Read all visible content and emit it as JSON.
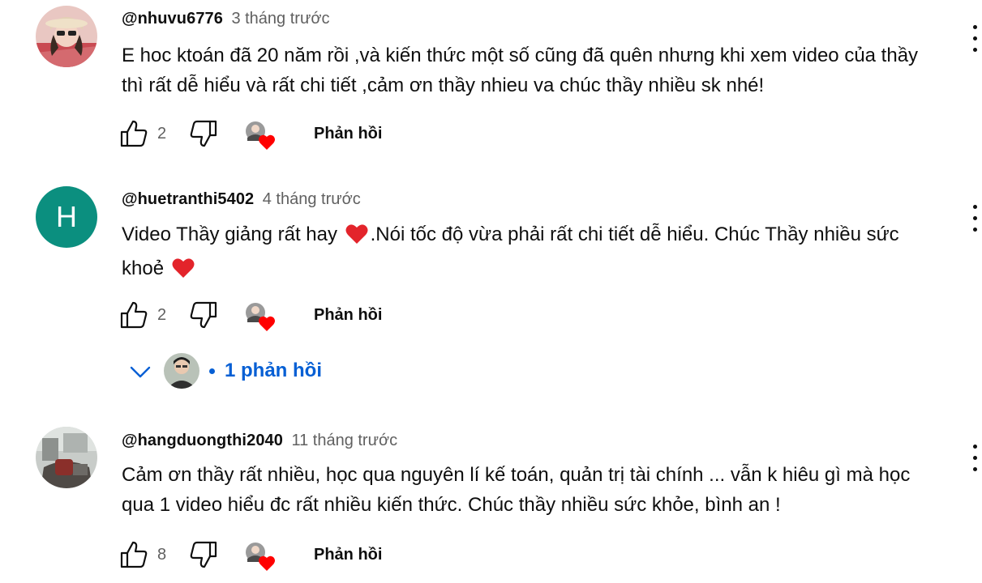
{
  "comments": [
    {
      "author": "@nhuvu6776",
      "time": "3 tháng trước",
      "text": "E hoc ktoán đã 20 năm rồi ,và kiến thức một số cũng đã quên nhưng khi xem video của thầy thì rất dễ hiểu và rất chi tiết ,cảm ơn thầy nhieu va chúc thầy nhiều sk nhé!",
      "likes": "2",
      "reply_label": "Phản hồi"
    },
    {
      "author": "@huetranthi5402",
      "avatar_letter": "H",
      "time": "4 tháng trước",
      "text_part1": "Video Thầy giảng rất hay",
      "text_part2": ".Nói tốc độ vừa phải rất chi tiết dễ hiểu. Chúc Thầy nhiều sức khoẻ",
      "likes": "2",
      "reply_label": "Phản hồi",
      "replies_label": "1 phản hồi"
    },
    {
      "author": "@hangduongthi2040",
      "time": "11 tháng trước",
      "text": "Cảm ơn thầy rất nhiều, học qua nguyên lí kế toán, quản trị tài chính ... vẫn k hiêu gì mà học qua 1 video hiểu đc rất nhiều kiến thức. Chúc thầy nhiều sức khỏe, bình an !",
      "likes": "8",
      "reply_label": "Phản hồi"
    }
  ],
  "icons": {
    "like": "thumb-up-icon",
    "dislike": "thumb-down-icon",
    "creator_heart": "creator-heart-icon",
    "more": "more-vert-icon",
    "expand": "chevron-down-icon"
  },
  "colors": {
    "text": "#0f0f0f",
    "secondary": "#606060",
    "link": "#065fd4",
    "heart": "#ff0000",
    "avatar_h": "#0b8f7f"
  }
}
